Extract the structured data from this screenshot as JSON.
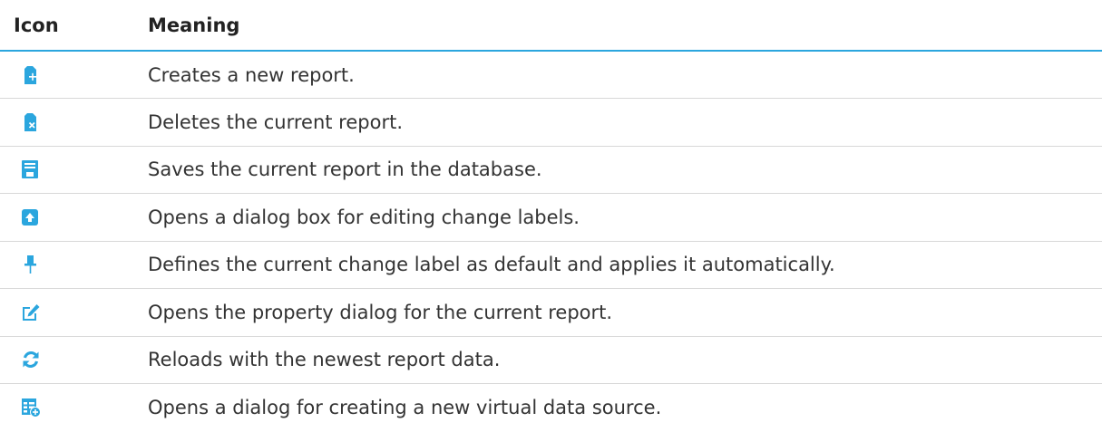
{
  "header": {
    "icon_label": "Icon",
    "meaning_label": "Meaning"
  },
  "colors": {
    "accent": "#2ba6de",
    "text": "#333333"
  },
  "rows": [
    {
      "icon": "new-report-icon",
      "meaning": "Creates a new report."
    },
    {
      "icon": "delete-report-icon",
      "meaning": "Deletes the current report."
    },
    {
      "icon": "save-icon",
      "meaning": "Saves the current report in the database."
    },
    {
      "icon": "change-labels-icon",
      "meaning": "Opens a dialog box for editing change labels."
    },
    {
      "icon": "pin-icon",
      "meaning": "Defines the current change label as default and applies it automatically."
    },
    {
      "icon": "edit-properties-icon",
      "meaning": "Opens the property dialog for the current report."
    },
    {
      "icon": "reload-icon",
      "meaning": "Reloads with the newest report data."
    },
    {
      "icon": "add-data-source-icon",
      "meaning": "Opens a dialog for creating a new virtual data source."
    }
  ]
}
